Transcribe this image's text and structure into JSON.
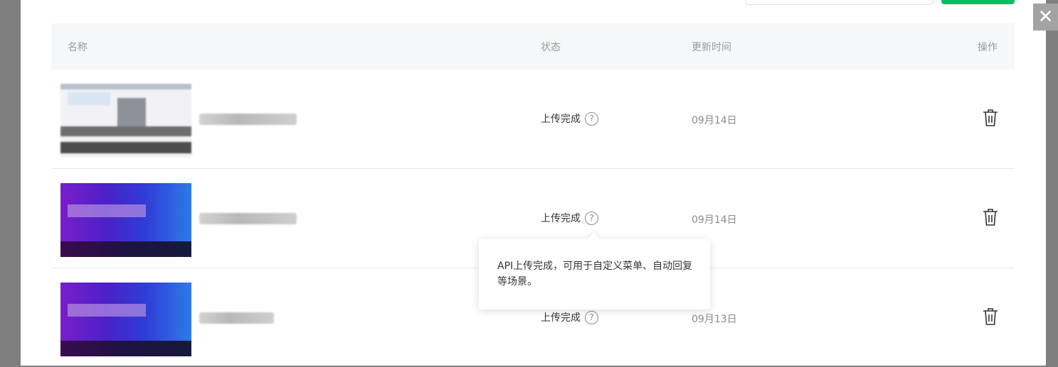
{
  "table": {
    "headers": {
      "name": "名称",
      "status": "状态",
      "updated": "更新时间",
      "actions": "操作"
    },
    "rows": [
      {
        "status": "上传完成",
        "help_icon": "?",
        "date": "09月14日",
        "thumbnail_style": "light",
        "delete_icon": "trash-icon"
      },
      {
        "status": "上传完成",
        "help_icon": "?",
        "date": "09月14日",
        "thumbnail_style": "purple",
        "delete_icon": "trash-icon"
      },
      {
        "status": "上传完成",
        "help_icon": "?",
        "date": "09月13日",
        "thumbnail_style": "purple",
        "delete_icon": "trash-icon"
      }
    ]
  },
  "tooltip": {
    "text": "API上传完成，可用于自定义菜单、自动回复等场景。"
  },
  "dialog": {
    "close_icon": "✕"
  },
  "colors": {
    "accent_green": "#07c160",
    "header_bg": "#f6f7f8",
    "overlay": "#7f7f7f"
  }
}
